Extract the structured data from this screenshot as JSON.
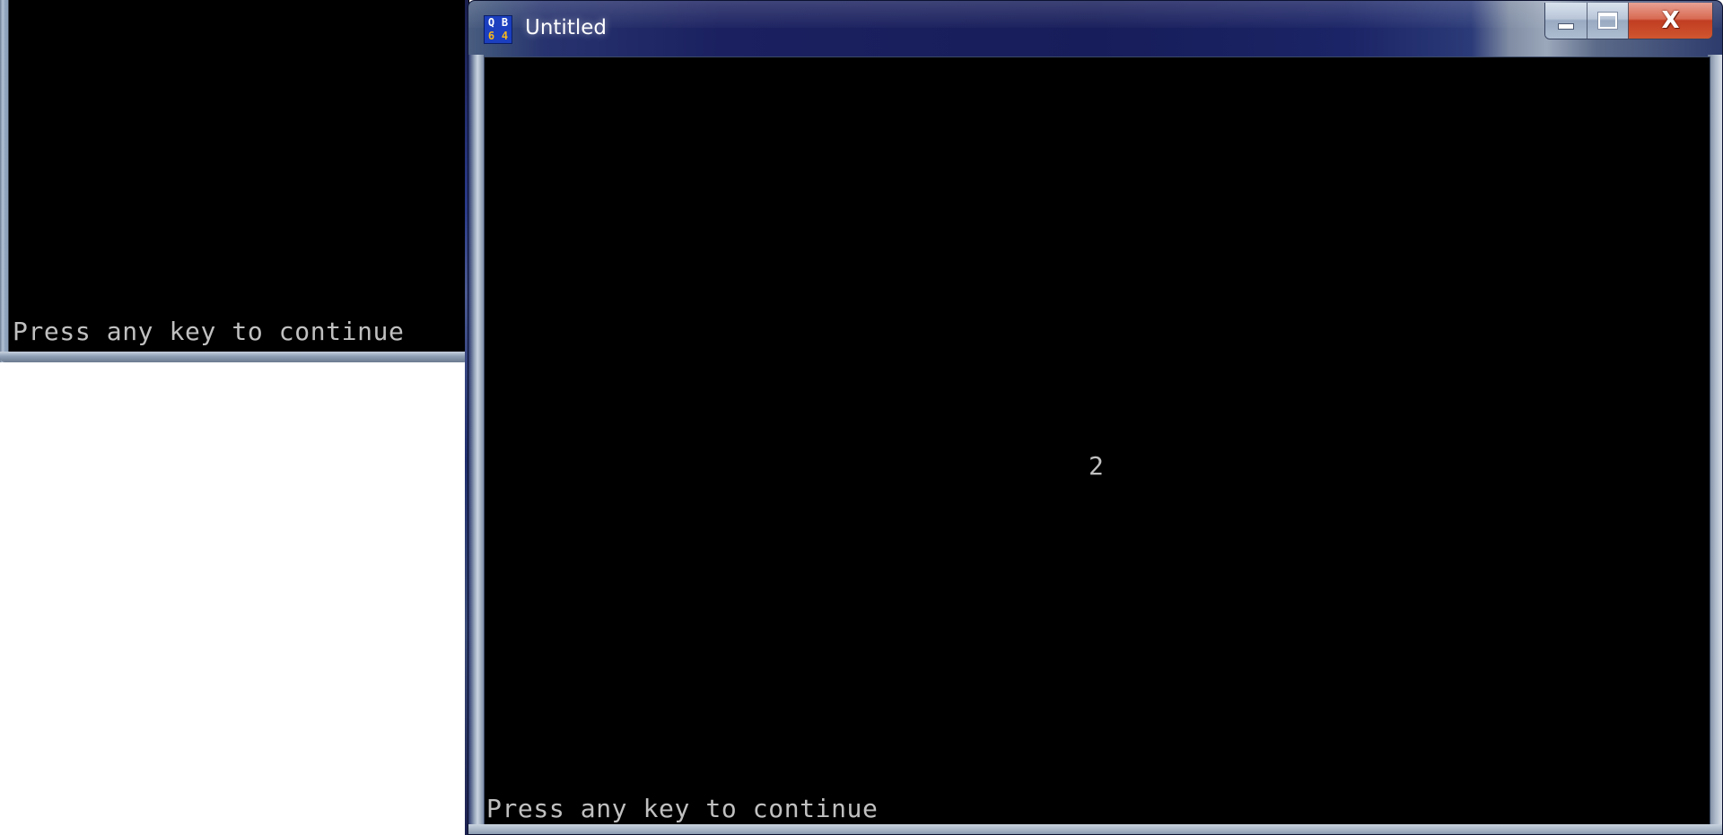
{
  "background_console": {
    "message": "Press any key to continue"
  },
  "window": {
    "title": "Untitled",
    "icon": {
      "name": "qb64-app-icon",
      "letters": [
        "Q",
        "B",
        "6",
        "4"
      ]
    },
    "controls": {
      "minimize_icon": "minimize-icon",
      "maximize_icon": "maximize-icon",
      "close_icon": "close-icon",
      "close_glyph": "X"
    }
  },
  "console": {
    "printed_value": "2",
    "message": "Press any key to continue",
    "text_color": "#c0c0c0",
    "background_color": "#000000"
  },
  "colors": {
    "titlebar": "#1b2160",
    "close_button": "#c13d22",
    "icon_blue": "#1c3fbf",
    "icon_yellow": "#f7b81c"
  }
}
